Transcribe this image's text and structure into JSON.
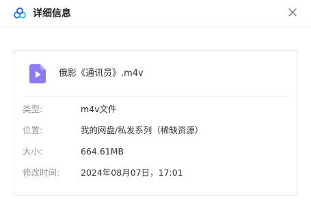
{
  "dialog": {
    "title": "详细信息",
    "logo_icon": "baidu-netdisk-cloud-icon",
    "close_icon": "close-icon"
  },
  "file": {
    "name": "俄影《通讯员》.m4v",
    "icon": "video-file-icon",
    "icon_color": "#8b7cf6"
  },
  "details": [
    {
      "label": "类型:",
      "value": "m4v文件"
    },
    {
      "label": "位置:",
      "value": "我的网盘/私发系列（稀缺资源）"
    },
    {
      "label": "大小:",
      "value": "664.61MB"
    },
    {
      "label": "修改时间:",
      "value": "2024年08月07日，17:01"
    }
  ]
}
